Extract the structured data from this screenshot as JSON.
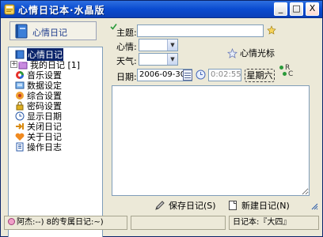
{
  "window": {
    "title": "心情日记本·水晶版",
    "buttons": {
      "minimize": "_",
      "maximize": "□",
      "close": "X"
    }
  },
  "left": {
    "banner_label": "心情日记",
    "tree": [
      {
        "label": "心情日记",
        "icon": "book-icon",
        "selected": true
      },
      {
        "label": "我的日记 [1]",
        "icon": "folder-icon",
        "expandable": true,
        "expander": "+"
      },
      {
        "label": "音乐设置",
        "icon": "music-icon"
      },
      {
        "label": "数据设定",
        "icon": "data-icon"
      },
      {
        "label": "综合设置",
        "icon": "settings-icon"
      },
      {
        "label": "密码设置",
        "icon": "lock-icon"
      },
      {
        "label": "显示日期",
        "icon": "clock-icon"
      },
      {
        "label": "关闭日记",
        "icon": "close-arrow-icon"
      },
      {
        "label": "关于日记",
        "icon": "heart-icon"
      },
      {
        "label": "操作日志",
        "icon": "log-icon"
      }
    ]
  },
  "form": {
    "subject_label": "主题:",
    "subject_value": "",
    "mood_label": "心情:",
    "mood_value": "",
    "weather_label": "天气:",
    "weather_value": "",
    "mood_cursor_label": "心情光标",
    "date_label": "日期:",
    "date_value": "2006-09-30",
    "time_value": "0:02:55",
    "weekday_label": "星期六",
    "radio_r": "R",
    "radio_c": "C",
    "save_label": "保存日记(S)",
    "new_label": "新建日记(N)"
  },
  "status": {
    "left_text": "阿杰:--) 8的专属日记:~)",
    "right_text": "日记本:『大四』"
  },
  "colors": {
    "title_bar": "#0a4bd0",
    "selection": "#0a246a",
    "window_bg": "#ece9d8"
  }
}
